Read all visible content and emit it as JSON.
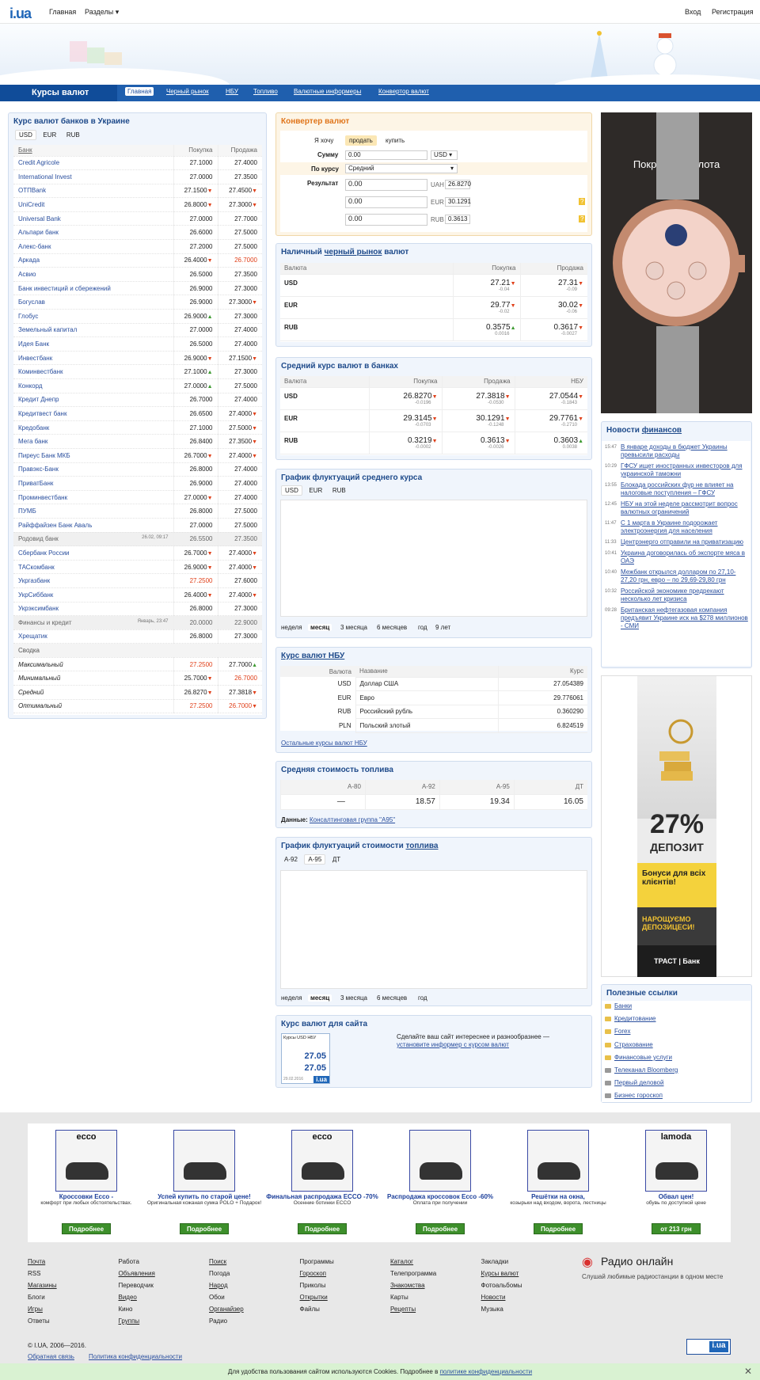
{
  "topbar": {
    "logo": "i.ua",
    "nav": [
      "Главная",
      "Разделы ▾"
    ],
    "login": "Вход",
    "register": "Регистрация"
  },
  "section_title": "Курсы валют",
  "menu": [
    "Главная",
    "Черный рынок",
    "НБУ",
    "Топливо",
    "Валютные информеры",
    "Конвертор валют"
  ],
  "banks": {
    "title": "Курс валют банков в Украине",
    "currencies": [
      "USD",
      "EUR",
      "RUB"
    ],
    "headers": [
      "Банк",
      "Покупка",
      "Продажа"
    ],
    "rows": [
      [
        "Credit Agricole",
        "27.1000",
        "",
        "27.4000",
        ""
      ],
      [
        "International Invest",
        "27.0000",
        "",
        "27.3500",
        ""
      ],
      [
        "ОТПBank",
        "27.1500",
        "▼",
        "27.4500",
        "▼"
      ],
      [
        "UniCredit",
        "26.8000",
        "▼",
        "27.3000",
        "▼"
      ],
      [
        "Universal Bank",
        "27.0000",
        "",
        "27.7000",
        ""
      ],
      [
        "Альпари банк",
        "26.6000",
        "",
        "27.5000",
        ""
      ],
      [
        "Алекс-банк",
        "27.2000",
        "",
        "27.5000",
        ""
      ],
      [
        "Аркада",
        "26.4000",
        "▼",
        "26.7000",
        ""
      ],
      [
        "Асвио",
        "26.5000",
        "",
        "27.3500",
        ""
      ],
      [
        "Банк инвестиций и сбережений",
        "26.9000",
        "",
        "27.3000",
        ""
      ],
      [
        "Богуслав",
        "26.9000",
        "",
        "27.3000",
        "▼"
      ],
      [
        "Глобус",
        "26.9000",
        "▲",
        "27.3000",
        ""
      ],
      [
        "Земельный капитал",
        "27.0000",
        "",
        "27.4000",
        ""
      ],
      [
        "Идея Банк",
        "26.5000",
        "",
        "27.4000",
        ""
      ],
      [
        "Инвестбанк",
        "26.9000",
        "▼",
        "27.1500",
        "▼"
      ],
      [
        "Коминвестбанк",
        "27.1000",
        "▲",
        "27.3000",
        ""
      ],
      [
        "Конкорд",
        "27.0000",
        "▲",
        "27.5000",
        ""
      ],
      [
        "Кредит Днепр",
        "26.7000",
        "",
        "27.4000",
        ""
      ],
      [
        "Кредитвест банк",
        "26.6500",
        "",
        "27.4000",
        "▼"
      ],
      [
        "Кредобанк",
        "27.1000",
        "",
        "27.5000",
        "▼"
      ],
      [
        "Мега банк",
        "26.8400",
        "",
        "27.3500",
        "▼"
      ],
      [
        "Пиреус Банк МКБ",
        "26.7000",
        "▼",
        "27.4000",
        "▼"
      ],
      [
        "Правэкс-Банк",
        "26.8000",
        "",
        "27.4000",
        ""
      ],
      [
        "ПриватБанк",
        "26.9000",
        "",
        "27.4000",
        ""
      ],
      [
        "Проминвестбанк",
        "27.0000",
        "▼",
        "27.4000",
        ""
      ],
      [
        "ПУМБ",
        "26.8000",
        "",
        "27.5000",
        ""
      ],
      [
        "Райффайзен Банк Аваль",
        "27.0000",
        "",
        "27.5000",
        ""
      ],
      [
        "Родовид банк",
        "26.5500",
        "",
        "27.3500",
        ""
      ],
      [
        "Сбербанк России",
        "26.7000",
        "▼",
        "27.4000",
        "▼"
      ],
      [
        "ТАСкомбанк",
        "26.9000",
        "▼",
        "27.4000",
        "▼"
      ],
      [
        "Укргазбанк",
        "27.2500",
        "",
        "27.6000",
        ""
      ],
      [
        "УкрСиббанк",
        "26.4000",
        "▼",
        "27.4000",
        "▼"
      ],
      [
        "Укрэксимбанк",
        "26.8000",
        "",
        "27.3000",
        ""
      ],
      [
        "Финансы и кредит",
        "20.0000",
        "",
        "22.9000",
        ""
      ],
      [
        "Хрещатик",
        "26.8000",
        "",
        "27.3000",
        ""
      ]
    ],
    "note_rodovid": "26.02, 09:17",
    "note_finance": "Январь, 23:47",
    "summary_label": "Сводка",
    "summary": [
      [
        "Максимальный",
        "27.2500",
        "",
        "27.7000",
        "▲"
      ],
      [
        "Минимальный",
        "25.7000",
        "▼",
        "26.7000",
        ""
      ],
      [
        "Средний",
        "26.8270",
        "▼",
        "27.3818",
        "▼"
      ],
      [
        "Оптимальный",
        "27.2500",
        "",
        "26.7000",
        "▼"
      ]
    ]
  },
  "converter": {
    "title": "Конвертер валют",
    "want_label": "Я хочу",
    "sell": "продать",
    "buy": "купить",
    "sum_label": "Сумму",
    "sum": "0.00",
    "currency": "USD",
    "rate_label": "По курсу",
    "rate": "Средний",
    "result_label": "Результат",
    "results": [
      [
        "0.00",
        "UAH",
        "26.8270"
      ],
      [
        "0.00",
        "EUR",
        "30.1291"
      ],
      [
        "0.00",
        "RUB",
        "0.3613"
      ]
    ],
    "help": "?"
  },
  "black": {
    "title_pre": "Наличный",
    "title_link": "черный рынок",
    "title_post": "валют",
    "headers": [
      "Валюта",
      "Покупка",
      "Продажа"
    ],
    "rows": [
      [
        "USD",
        "27.21",
        "▼",
        "-0.04",
        "27.31",
        "▼",
        "-0.09"
      ],
      [
        "EUR",
        "29.77",
        "▼",
        "-0.02",
        "30.02",
        "▼",
        "-0.06"
      ],
      [
        "RUB",
        "0.3575",
        "▲",
        "0.0016",
        "0.3617",
        "▼",
        "-0.0027"
      ]
    ]
  },
  "avg": {
    "title": "Средний курс валют в банках",
    "headers": [
      "Валюта",
      "Покупка",
      "Продажа",
      "НБУ"
    ],
    "rows": [
      [
        "USD",
        "26.8270",
        "▼",
        "-0.0196",
        "27.3818",
        "▼",
        "-0.0530",
        "27.0544",
        "▼",
        "-0.1843"
      ],
      [
        "EUR",
        "29.3145",
        "▼",
        "-0.0703",
        "30.1291",
        "▼",
        "-0.1248",
        "29.7761",
        "▼",
        "-0.2710"
      ],
      [
        "RUB",
        "0.3219",
        "▼",
        "-0.0002",
        "0.3613",
        "▼",
        "-0.0026",
        "0.3603",
        "▲",
        "0.0038"
      ]
    ]
  },
  "fluct": {
    "title": "График флуктуаций среднего курса",
    "currencies": [
      "USD",
      "EUR",
      "RUB"
    ],
    "periods": [
      "неделя",
      "месяц",
      "3 месяца",
      "6 месяцев",
      "год",
      "9 лет"
    ]
  },
  "nbu": {
    "title": "Курс валют НБУ",
    "headers": [
      "Валюта",
      "Название",
      "Курс"
    ],
    "rows": [
      [
        "USD",
        "Доллар США",
        "27.054389"
      ],
      [
        "EUR",
        "Евро",
        "29.776061"
      ],
      [
        "RUB",
        "Российский рубль",
        "0.360290"
      ],
      [
        "PLN",
        "Польский злотый",
        "6.824519"
      ]
    ],
    "more": "Остальные курсы валют НБУ"
  },
  "fuel": {
    "title": "Средняя стоимость топлива",
    "headers": [
      "А-80",
      "А-92",
      "А-95",
      "ДТ"
    ],
    "values": [
      "—",
      "18.57",
      "19.34",
      "16.05"
    ],
    "source_label": "Данные:",
    "source": "Консалтинговая группа \"А95\""
  },
  "fuelchart": {
    "title_pre": "График флуктуаций стоимости",
    "title_link": "топлива",
    "types": [
      "А-92",
      "А-95",
      "ДТ"
    ],
    "periods": [
      "неделя",
      "месяц",
      "3 месяца",
      "6 месяцев",
      "год"
    ]
  },
  "site": {
    "title": "Курс валют для сайта",
    "text": "Сделайте ваш сайт интереснее и разнообразнее —",
    "link": "установите информер с курсом валют",
    "informer_title": "Курсы USD НБУ",
    "v1": "27.05",
    "v2": "27.05",
    "date": "29.02.2016",
    "brand": "i.ua"
  },
  "watch_ad": "Покриття з золота",
  "news": {
    "title_pre": "Новости",
    "title_link": "финансов",
    "items": [
      [
        "15:47",
        "В январе доходы в бюджет Украины превысили расходы"
      ],
      [
        "10:29",
        "ГФСУ ищет иностранных инвесторов для украинской таможни"
      ],
      [
        "13:55",
        "Блокада российских фур не влияет на налоговые поступления – ГФСУ"
      ],
      [
        "12:45",
        "НБУ на этой неделе рассмотрит вопрос валютных ограничений"
      ],
      [
        "11:47",
        "С 1 марта в Украине подорожает электроэнергия для населения"
      ],
      [
        "11:33",
        "Центрэнерго отправили на приватизацию"
      ],
      [
        "10:41",
        "Украина договорилась об экспорте мяса в ОАЭ"
      ],
      [
        "10:40",
        "Межбанк открылся долларом по 27,10-27,20 грн, евро – по 29,69-29,80 грн"
      ],
      [
        "10:32",
        "Российской экономике предрекают несколько лет кризиса"
      ],
      [
        "09:28",
        "Британская нефтегазовая компания предъявит Украине иск на $278 миллионов - СМИ"
      ]
    ]
  },
  "bank_ad": {
    "pct": "27%",
    "dep": "ДЕПОЗИТ",
    "bonus": "Бонуси для всіх клієнтів!",
    "more": "НАРОЩУЄМО ДЕПОЗИЦЕСИ!",
    "brand": "ТРАСТ | Банк"
  },
  "links": {
    "title": "Полезные ссылки",
    "items": [
      "Банки",
      "Кредитование",
      "Forex",
      "Страхование",
      "Финансовые услуги",
      "Телеканал Bloomberg",
      "Первый деловой",
      "Бизнес гороскоп"
    ]
  },
  "ads": [
    {
      "brand": "ecco",
      "h": "Кроссовки Ecco -",
      "d": "комфорт при любых обстоятельствах.",
      "btn": "Подробнее"
    },
    {
      "brand": "",
      "h": "Успей купить по старой цене!",
      "d": "Оригинальная кожаная сумка POLO + Подарок!",
      "btn": "Подробнее"
    },
    {
      "brand": "ecco",
      "h": "Финальная распродажа ECCO -70%",
      "d": "Осенние ботинки ECCO",
      "btn": "Подробнее"
    },
    {
      "brand": "",
      "h": "Распродажа кроссовок Ecco -60%",
      "d": "Оплата при получении",
      "btn": "Подробнее"
    },
    {
      "brand": "",
      "h": "Решётки на окна,",
      "d": "козырьки над входом, ворота, лестницы",
      "btn": "Подробнее"
    },
    {
      "brand": "lamoda",
      "h": "Обвал цен!",
      "d": "обувь по доступной цене",
      "btn": "от 213 грн"
    }
  ],
  "footer": {
    "cols": [
      [
        "Почта",
        "RSS",
        "Магазины",
        "Блоги",
        "Игры",
        "Ответы"
      ],
      [
        "Работа",
        "Объявления",
        "Переводчик",
        "Видео",
        "Кино",
        "Группы"
      ],
      [
        "Поиск",
        "Погода",
        "Народ",
        "Обои",
        "Органайзер",
        "Радио"
      ],
      [
        "Программы",
        "Гороскоп",
        "Приколы",
        "Открытки",
        "Файлы"
      ],
      [
        "Каталог",
        "Телепрограмма",
        "Знакомства",
        "Карты",
        "Рецепты"
      ],
      [
        "Закладки",
        "Курсы валют",
        "Фотоальбомы",
        "Новости",
        "Музыка"
      ]
    ],
    "radio_title": "Радио онлайн",
    "radio_text": "Слушай любимые радиостанции в одном месте",
    "copyright": "© I.UA, 2006—2016.",
    "feedback": "Обратная связь",
    "privacy": "Политика конфиденциальности"
  },
  "cookie": {
    "text": "Для удобства пользования сайтом используются Cookies. Подробнее в",
    "link": "политике конфиденциальности"
  }
}
